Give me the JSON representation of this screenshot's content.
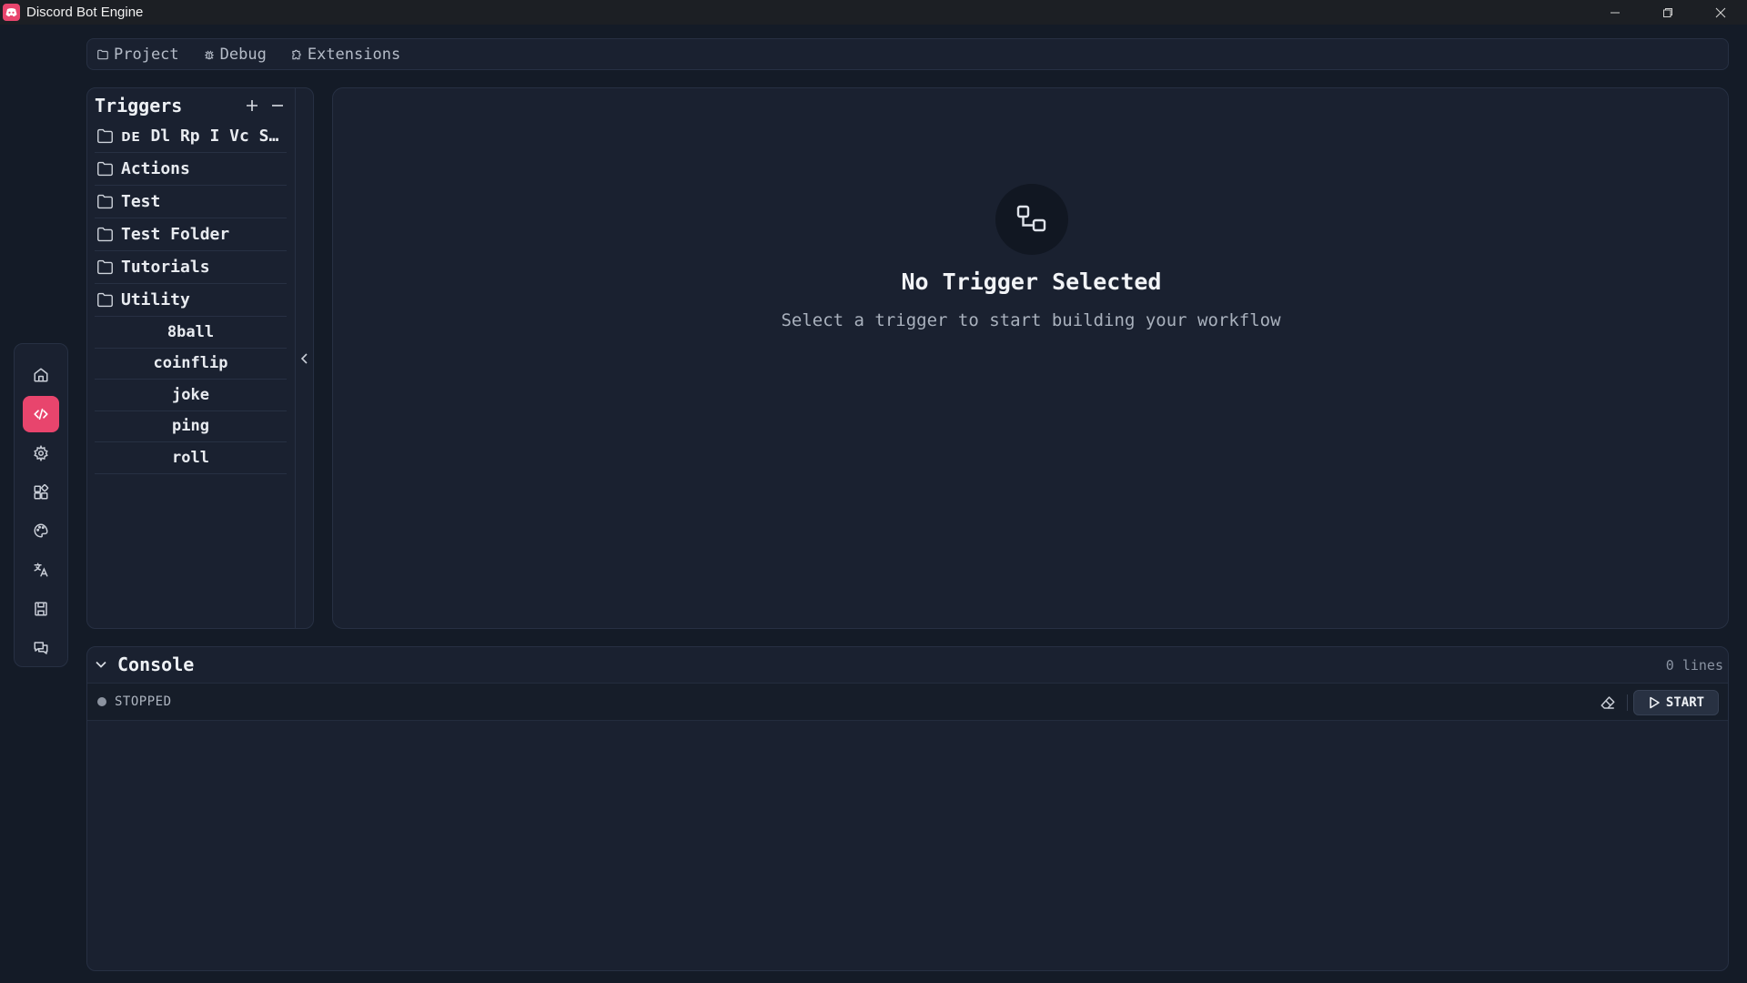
{
  "window": {
    "title": "Discord Bot Engine"
  },
  "tabs": [
    {
      "label": "Project",
      "icon": "folder-icon"
    },
    {
      "label": "Debug",
      "icon": "bug-icon"
    },
    {
      "label": "Extensions",
      "icon": "puzzle-icon"
    }
  ],
  "left_nav": {
    "items": [
      {
        "icon": "home-icon"
      },
      {
        "icon": "code-icon",
        "active": true
      },
      {
        "icon": "gear-icon"
      },
      {
        "icon": "widgets-icon"
      },
      {
        "icon": "palette-icon"
      },
      {
        "icon": "translate-icon"
      },
      {
        "icon": "save-icon"
      },
      {
        "icon": "chat-icon"
      }
    ]
  },
  "triggers": {
    "title": "Triggers",
    "folders": [
      {
        "label": "ᴅᴇ Dl Rp I Vc S…"
      },
      {
        "label": "Actions"
      },
      {
        "label": "Test"
      },
      {
        "label": "Test Folder"
      },
      {
        "label": "Tutorials"
      },
      {
        "label": "Utility"
      }
    ],
    "commands": [
      {
        "label": "8ball"
      },
      {
        "label": "coinflip"
      },
      {
        "label": "joke"
      },
      {
        "label": "ping"
      },
      {
        "label": "roll"
      }
    ]
  },
  "editor": {
    "empty_title": "No Trigger Selected",
    "empty_subtitle": "Select a trigger to start building your workflow"
  },
  "console": {
    "title": "Console",
    "lines_label": "0 lines",
    "status": "STOPPED",
    "start_label": "START"
  },
  "colors": {
    "accent": "#e8456d",
    "background": "#141b27",
    "panel": "#1a2130",
    "border": "#273043"
  }
}
